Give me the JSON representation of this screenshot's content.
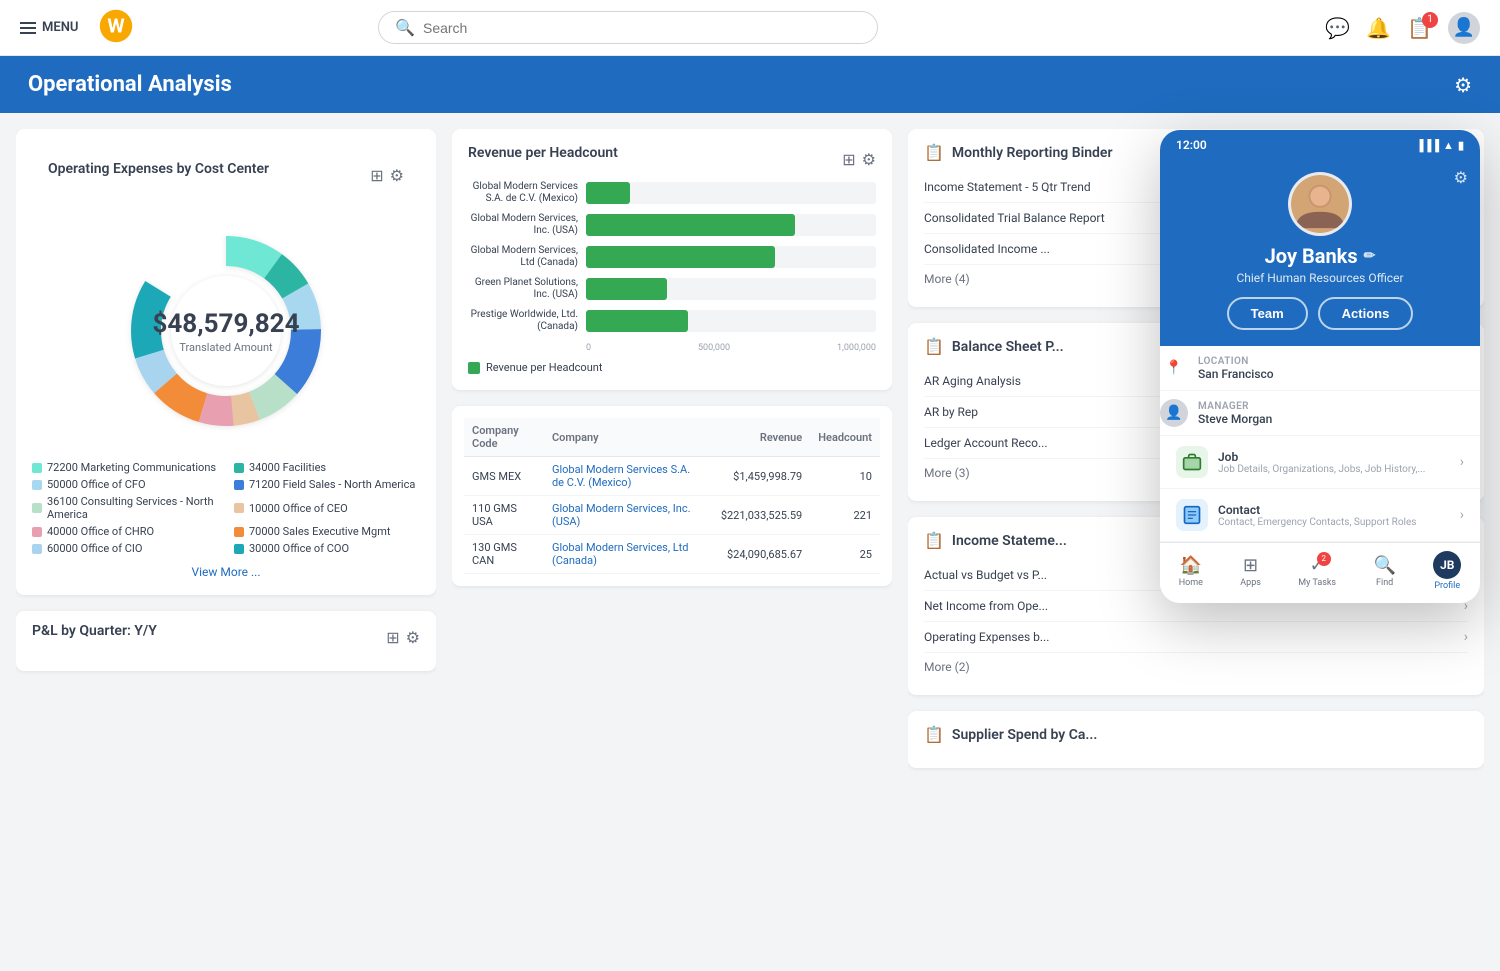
{
  "nav": {
    "menu_label": "MENU",
    "search_placeholder": "Search",
    "badge_count": "1"
  },
  "page_header": {
    "title": "Operational Analysis",
    "settings_icon": "⚙"
  },
  "donut_card": {
    "title": "Operating Expenses by Cost Center",
    "amount": "$48,579,824",
    "subtitle": "Translated Amount",
    "view_more": "View More ...",
    "segments": [
      {
        "color": "#6ee7d4",
        "label": "72200 Marketing Communications",
        "pct": 12
      },
      {
        "color": "#2db5a3",
        "label": "34000 Facilities",
        "pct": 8
      },
      {
        "color": "#a8d8f0",
        "label": "50000 Office of CFO",
        "pct": 10
      },
      {
        "color": "#3b7dd8",
        "label": "71200 Field Sales - North America",
        "pct": 14
      },
      {
        "color": "#b8e0c8",
        "label": "36100 Consulting Services - North America",
        "pct": 9
      },
      {
        "color": "#e8c4a0",
        "label": "10000 Office of CEO",
        "pct": 5
      },
      {
        "color": "#e8a0b0",
        "label": "40000 Office of CHRO",
        "pct": 7
      },
      {
        "color": "#f28c38",
        "label": "70000 Sales Executive Mgmt",
        "pct": 11
      },
      {
        "color": "#a8d4f0",
        "label": "60000 Office of CIO",
        "pct": 8
      },
      {
        "color": "#1da8b8",
        "label": "30000 Office of COO",
        "pct": 16
      }
    ]
  },
  "pl_card": {
    "title": "P&L by Quarter: Y/Y"
  },
  "bar_chart": {
    "title": "Revenue per Headcount",
    "legend": "Revenue per Headcount",
    "bars": [
      {
        "label": "Global Modern Services S.A. de C.V. (Mexico)",
        "value": 15,
        "max": 100
      },
      {
        "label": "Global Modern Services, Inc. (USA)",
        "value": 72,
        "max": 100
      },
      {
        "label": "Global Modern Services, Ltd (Canada)",
        "value": 65,
        "max": 100
      },
      {
        "label": "Green Planet Solutions, Inc. (USA)",
        "value": 28,
        "max": 100
      },
      {
        "label": "Prestige Worldwide, Ltd. (Canada)",
        "value": 35,
        "max": 100
      }
    ],
    "axis_labels": [
      "0",
      "500,000",
      "1,000,000"
    ]
  },
  "revenue_table": {
    "columns": [
      "Company Code",
      "Company",
      "Revenue",
      "Headcount"
    ],
    "rows": [
      {
        "code": "GMS MEX",
        "company": "Global Modern Services S.A. de C.V. (Mexico)",
        "revenue": "$1,459,998.79",
        "headcount": "10"
      },
      {
        "code": "110 GMS USA",
        "company": "Global Modern Services, Inc. (USA)",
        "revenue": "$221,033,525.59",
        "headcount": "221"
      },
      {
        "code": "130 GMS CAN",
        "company": "Global Modern Services, Ltd (Canada)",
        "revenue": "$24,090,685.67",
        "headcount": "25"
      }
    ]
  },
  "monthly_binder": {
    "title": "Monthly Reporting Binder",
    "items": [
      "Income Statement - 5 Qtr Trend",
      "Consolidated Trial Balance Report",
      "Consolidated Income ..."
    ],
    "more": "More (4)"
  },
  "balance_sheet": {
    "title": "Balance Sheet P...",
    "items": [
      "AR Aging Analysis",
      "AR by Rep",
      "Ledger Account Reco..."
    ],
    "more": "More (3)"
  },
  "income_statement": {
    "title": "Income Stateme...",
    "items": [
      "Actual vs Budget vs P...",
      "Net Income from Ope...",
      "Operating Expenses b..."
    ],
    "more": "More (2)"
  },
  "supplier_card": {
    "title": "Supplier Spend by Ca..."
  },
  "phone": {
    "status_time": "12:00",
    "profile": {
      "name": "Joy Banks",
      "title": "Chief Human Resources Officer",
      "team_btn": "Team",
      "actions_btn": "Actions"
    },
    "location": {
      "label": "Location",
      "value": "San Francisco"
    },
    "manager": {
      "label": "Manager",
      "value": "Steve Morgan"
    },
    "job": {
      "label": "Job",
      "sub": "Job Details, Organizations, Jobs, Job History,..."
    },
    "contact": {
      "label": "Contact",
      "sub": "Contact, Emergency Contacts, Support Roles"
    },
    "bottom_nav": [
      {
        "icon": "🏠",
        "label": "Home",
        "active": false
      },
      {
        "icon": "⊞",
        "label": "Apps",
        "active": false
      },
      {
        "icon": "✓",
        "label": "My Tasks",
        "active": false,
        "badge": "2"
      },
      {
        "icon": "🔍",
        "label": "Find",
        "active": false
      },
      {
        "icon": "👤",
        "label": "Profile",
        "active": true
      }
    ]
  }
}
